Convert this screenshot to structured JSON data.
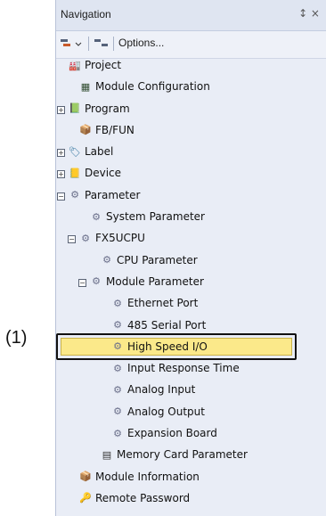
{
  "callout": "(1)",
  "panel": {
    "title": "Navigation",
    "pin_glyph": "↕ ×",
    "toolbar": {
      "options_label": "Options..."
    }
  },
  "tree": [
    {
      "label": "Project",
      "icon": "project-icon",
      "indent": 0,
      "expander": null
    },
    {
      "label": "Module Configuration",
      "icon": "module-config-icon",
      "indent": 1,
      "expander": null
    },
    {
      "label": "Program",
      "icon": "program-icon",
      "indent": 0,
      "expander": "plus"
    },
    {
      "label": "FB/FUN",
      "icon": "fb-fun-icon",
      "indent": 1,
      "expander": null
    },
    {
      "label": "Label",
      "icon": "label-icon",
      "indent": 0,
      "expander": "plus"
    },
    {
      "label": "Device",
      "icon": "device-icon",
      "indent": 0,
      "expander": "plus"
    },
    {
      "label": "Parameter",
      "icon": "parameter-icon",
      "indent": 0,
      "expander": "minus"
    },
    {
      "label": "System Parameter",
      "icon": "system-parameter-icon",
      "indent": 2,
      "expander": null
    },
    {
      "label": "FX5UCPU",
      "icon": "cpu-folder-icon",
      "indent": 1,
      "expander": "minus"
    },
    {
      "label": "CPU Parameter",
      "icon": "cpu-parameter-icon",
      "indent": 3,
      "expander": null
    },
    {
      "label": "Module Parameter",
      "icon": "module-parameter-icon",
      "indent": 2,
      "expander": "minus"
    },
    {
      "label": "Ethernet Port",
      "icon": "ethernet-port-icon",
      "indent": 4,
      "expander": null
    },
    {
      "label": "485 Serial Port",
      "icon": "serial-port-icon",
      "indent": 4,
      "expander": null
    },
    {
      "label": "High Speed I/O",
      "icon": "high-speed-io-icon",
      "indent": 4,
      "expander": null,
      "selected": true
    },
    {
      "label": "Input Response Time",
      "icon": "input-response-icon",
      "indent": 4,
      "expander": null
    },
    {
      "label": "Analog Input",
      "icon": "analog-input-icon",
      "indent": 4,
      "expander": null
    },
    {
      "label": "Analog Output",
      "icon": "analog-output-icon",
      "indent": 4,
      "expander": null
    },
    {
      "label": "Expansion Board",
      "icon": "expansion-board-icon",
      "indent": 4,
      "expander": null
    },
    {
      "label": "Memory Card Parameter",
      "icon": "memory-card-icon",
      "indent": 3,
      "expander": null
    },
    {
      "label": "Module Information",
      "icon": "module-info-icon",
      "indent": 1,
      "expander": null
    },
    {
      "label": "Remote Password",
      "icon": "remote-password-icon",
      "indent": 1,
      "expander": null
    }
  ],
  "colors": {
    "selected_fill": "#fbe98a",
    "panel_bg": "#e9edf6"
  }
}
